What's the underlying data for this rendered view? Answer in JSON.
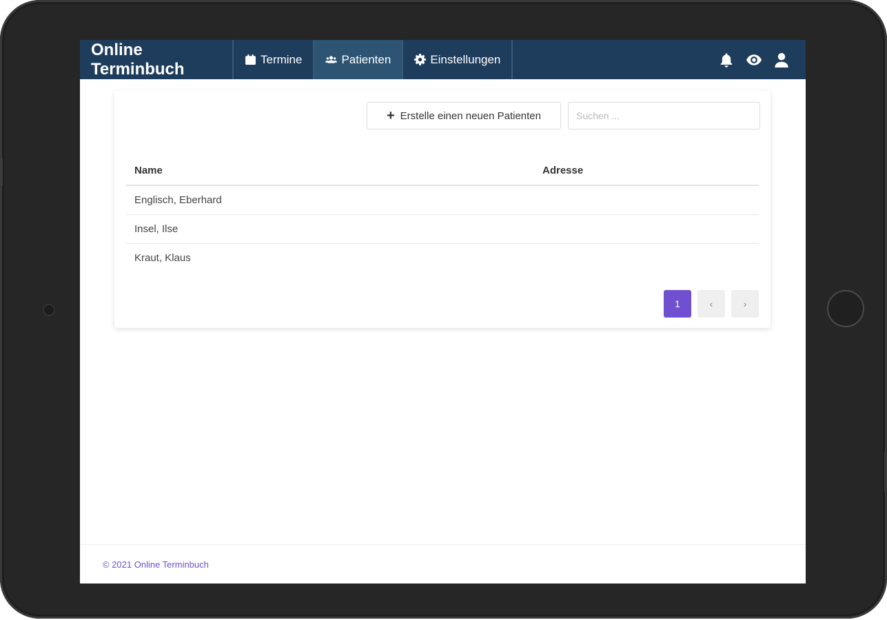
{
  "app": {
    "title": "Online Terminbuch"
  },
  "nav": {
    "items": [
      {
        "label": "Termine",
        "icon": "calendar-icon"
      },
      {
        "label": "Patienten",
        "icon": "users-icon"
      },
      {
        "label": "Einstellungen",
        "icon": "gear-icon"
      }
    ],
    "active": "Patienten",
    "right_icons": [
      "bell-icon",
      "eye-icon",
      "user-icon"
    ]
  },
  "toolbar": {
    "create_label": "Erstelle einen neuen Patienten",
    "search_placeholder": "Suchen ..."
  },
  "table": {
    "columns": [
      "Name",
      "Adresse"
    ],
    "rows": [
      {
        "name": "Englisch, Eberhard",
        "address": ""
      },
      {
        "name": "Insel, Ilse",
        "address": ""
      },
      {
        "name": "Kraut, Klaus",
        "address": ""
      }
    ]
  },
  "pagination": {
    "current": "1",
    "prev": "‹",
    "next": "›"
  },
  "footer": {
    "text": "© 2021 Online Terminbuch"
  },
  "colors": {
    "navbar": "#1e3d5c",
    "navbar_active": "#2e5473",
    "accent": "#7050d0",
    "device_frame": "#262626"
  }
}
